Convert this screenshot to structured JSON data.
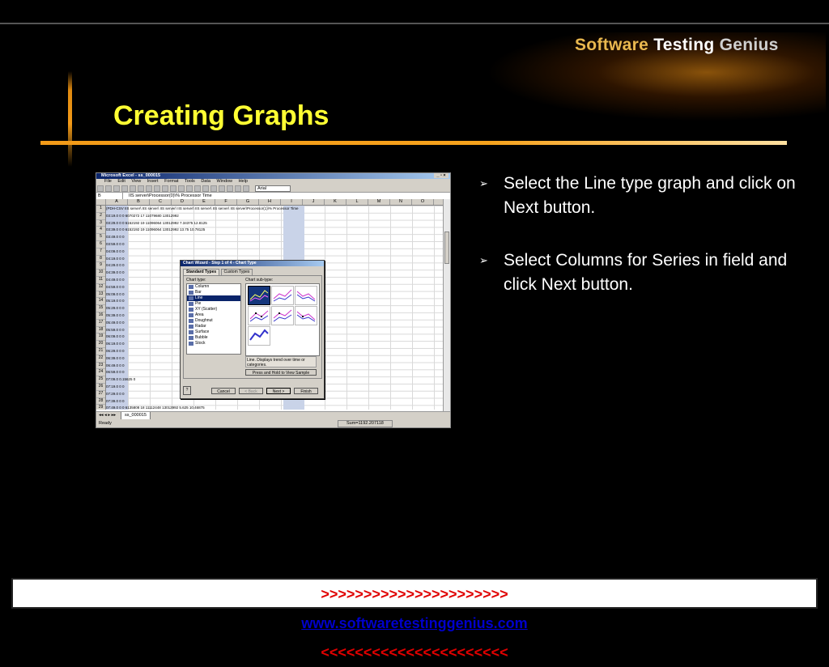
{
  "slide": {
    "logo": {
      "word1": "Software",
      "word2": "Testing",
      "word3": "Genius"
    },
    "title": "Creating Graphs",
    "bullets": [
      "Select the Line type graph and click on Next button.",
      "Select Columns for Series in field and click Next button."
    ],
    "footer": {
      "left_arrows": ">>>>>>>>>>>>>>>>>>>>>>",
      "link": "www.softwaretestinggenius.com",
      "right_arrows": "<<<<<<<<<<<<<<<<<<<<<<"
    },
    "colors": {
      "title": "#ffff33",
      "accent_bar": "#f29a18",
      "footer_text": "#e00000"
    }
  },
  "excel": {
    "window_title": "Microsoft Excel - ss_000015",
    "menu": [
      "File",
      "Edit",
      "View",
      "Insert",
      "Format",
      "Tools",
      "Data",
      "Window",
      "Help"
    ],
    "font_name": "Arial",
    "name_box": "B",
    "formula": "IIS server\\Processor(0)\\% Processor Time",
    "columns": [
      "A",
      "B",
      "C",
      "D",
      "E",
      "F",
      "G",
      "H",
      "I",
      "J",
      "K",
      "L",
      "M",
      "N",
      "O"
    ],
    "rows": [
      "1",
      "2",
      "3",
      "4",
      "5",
      "6",
      "7",
      "8",
      "9",
      "10",
      "11",
      "12",
      "13",
      "14",
      "15",
      "16",
      "17",
      "18",
      "19",
      "20",
      "21",
      "22",
      "23",
      "24",
      "25",
      "26",
      "27",
      "28",
      "29",
      "30",
      "31",
      "32",
      "33",
      "34",
      "35"
    ],
    "row_values": [
      "(PDH-CSV IIS server\\ IIS server\\ IIS server\\ IIS server\\ IIS server\\ IIS server\\ IIS server\\Processor(1)\\% Processor Time",
      "03:19.0   0   0   6070272   17   11079680   13012992",
      "03:29.0   0   0   6152192   19   11096064   13012992   7.34375   12.8125",
      "03:39.0   0   0   6152192   19   11096064   13012992   13.75   10.78125",
      "03:49.0   0   0",
      "03:59.0   0   0",
      "04:09.0   0   0",
      "04:19.0   0   0",
      "04:29.0   0   0",
      "04:39.0   0   0",
      "04:49.0   0   0",
      "04:59.0   0   0",
      "05:09.0   0   0",
      "05:19.0   0   0",
      "05:29.0   0   0",
      "05:39.0   0   0",
      "05:49.0   0   0",
      "05:59.0   0   0",
      "06:09.0   0   0",
      "06:19.0   0   0",
      "06:29.0   0   0",
      "06:39.0   0   0",
      "06:49.0   0   0",
      "06:59.0   0   0",
      "07:09.0   0.15625   0",
      "07:19.0   0   0",
      "07:29.0   0   0",
      "07:39.0   0   0",
      "07:49.0   0   0   6135808   18   11112448   13012992   5.625   10.46875",
      "07:59.0   0   0   6135808   18   11112448   13012992   6.09375   13.90625",
      "08:09.0   0   0   6094848   17   11104256   13012992   9.6875",
      "08:19.0   0   0   6094848   17   11104256   13012992   8.75   10.46875",
      "08:29.0   0   0   6176768   19   11120640   13012992   7.96875   11.71875",
      "08:39.0   0   0   6176768   19   11120640   13012992   8.59375   8.75",
      "08:49.0   0   0   6176768   19   11120640   13012992   5.9375   12.8125"
    ],
    "sheet_tab": "ss_000015",
    "status_ready": "Ready",
    "status_sum": "Sum=1192.207118"
  },
  "wizard": {
    "title": "Chart Wizard - Step 1 of 4 - Chart Type",
    "tabs": [
      "Standard Types",
      "Custom Types"
    ],
    "chart_type_label": "Chart type:",
    "chart_subtype_label": "Chart sub-type:",
    "chart_types": [
      "Column",
      "Bar",
      "Line",
      "Pie",
      "XY (Scatter)",
      "Area",
      "Doughnut",
      "Radar",
      "Surface",
      "Bubble",
      "Stock"
    ],
    "selected_type": "Line",
    "description": "Line. Displays trend over time or categories.",
    "press_hold": "Press and Hold to View Sample",
    "buttons": {
      "cancel": "Cancel",
      "back": "< Back",
      "next": "Next >",
      "finish": "Finish",
      "help": "?"
    }
  }
}
